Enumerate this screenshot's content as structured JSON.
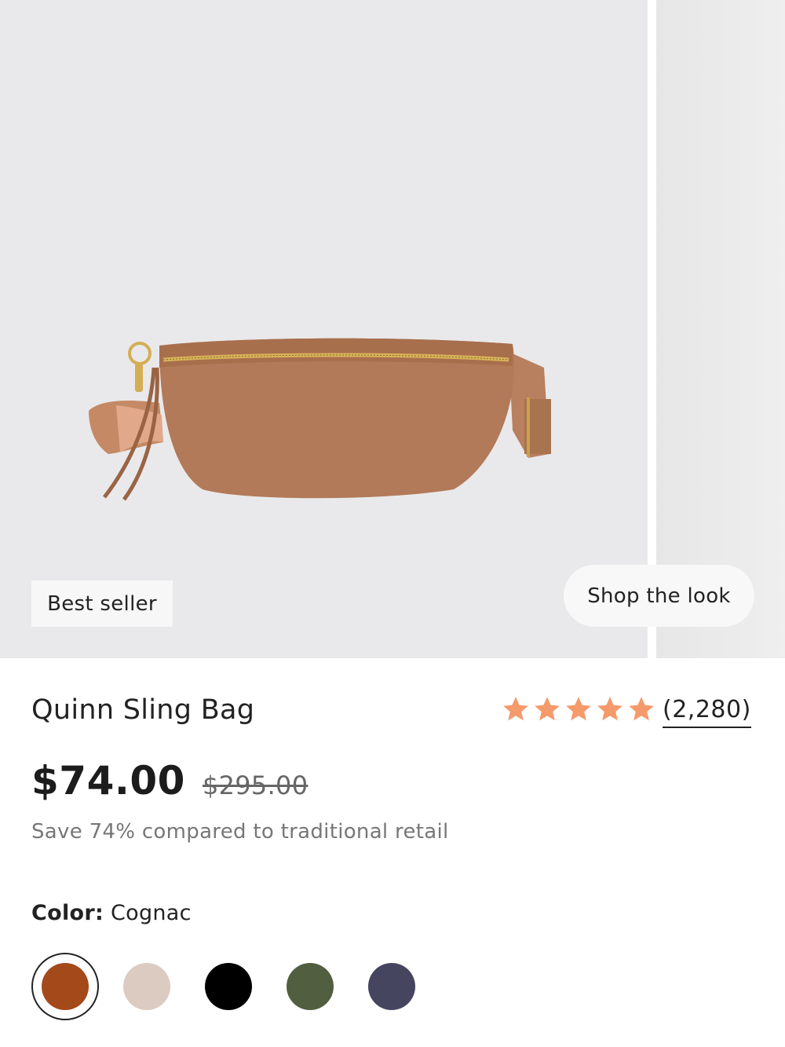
{
  "gallery": {
    "badge": "Best seller",
    "shop_the_look": "Shop the look"
  },
  "product": {
    "title": "Quinn Sling Bag",
    "rating": {
      "stars": 5,
      "review_count": "(2,280)",
      "star_color": "#f59a6b"
    },
    "price": "$74.00",
    "original_price": "$295.00",
    "savings_text": "Save 74% compared to traditional retail"
  },
  "color": {
    "label": "Color:",
    "selected": "Cognac",
    "swatches": [
      {
        "hex": "#a4491a",
        "selected": true
      },
      {
        "hex": "#dccbc1",
        "selected": false
      },
      {
        "hex": "#000000",
        "selected": false
      },
      {
        "hex": "#525e40",
        "selected": false
      },
      {
        "hex": "#46455f",
        "selected": false
      }
    ]
  }
}
